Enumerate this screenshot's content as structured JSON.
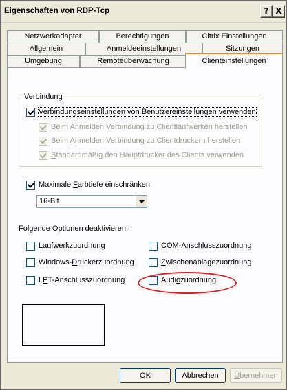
{
  "window": {
    "title": "Eigenschaften von RDP-Tcp",
    "help_label": "?",
    "close_label": "X"
  },
  "tabs": {
    "row1": [
      "Netzwerkadapter",
      "Berechtigungen",
      "Citrix Einstellungen"
    ],
    "row2": [
      "Allgemein",
      "Anmeldeeinstellungen",
      "Sitzungen"
    ],
    "row3": [
      "Umgebung",
      "Remoteüberwachung",
      "Clienteinstellungen"
    ],
    "active": "Clienteinstellungen"
  },
  "connection": {
    "group_title": "Verbindung",
    "use_user_settings": {
      "pre": "",
      "u": "V",
      "post": "erbindungseinstellungen von Benutzereinstellungen verwenden",
      "checked": true
    },
    "connect_drives": {
      "pre": "",
      "u": "B",
      "post": "eim Anmelden Verbindung zu Clientlaufwerken herstellen",
      "checked": true,
      "disabled": true
    },
    "connect_printers": {
      "pre": "Beim ",
      "u": "A",
      "post": "nmelden Verbindung zu Clientdruckern herstellen",
      "checked": true,
      "disabled": true
    },
    "default_printer": {
      "pre": "",
      "u": "S",
      "post": "tandardmäßig den Hauptdrucker des Clients verwenden",
      "checked": true,
      "disabled": true
    }
  },
  "color_depth": {
    "limit": {
      "pre": "Maximale ",
      "u": "F",
      "post": "arbtiefe einschränken",
      "checked": true
    },
    "selected": "16-Bit"
  },
  "disable": {
    "title": "Folgende Optionen deaktivieren:",
    "drive_mapping": {
      "pre": "",
      "u": "L",
      "post": "aufwerkzuordnung",
      "checked": false
    },
    "windows_printer": {
      "pre": "Windows-",
      "u": "D",
      "post": "ruckerzuordnung",
      "checked": false
    },
    "lpt_port": {
      "pre": "L",
      "u": "P",
      "post": "T-Anschlusszuordnung",
      "checked": false
    },
    "com_port": {
      "pre": "",
      "u": "C",
      "post": "OM-Anschlusszuordnung",
      "checked": false
    },
    "clipboard": {
      "pre": "",
      "u": "Z",
      "post": "wischenablagezuordnung",
      "checked": false
    },
    "audio": {
      "pre": "Audi",
      "u": "o",
      "post": "zuordnung",
      "checked": false
    }
  },
  "buttons": {
    "ok": "OK",
    "cancel": "Abbrechen",
    "apply_u": "Ü",
    "apply_post": "bernehmen"
  }
}
